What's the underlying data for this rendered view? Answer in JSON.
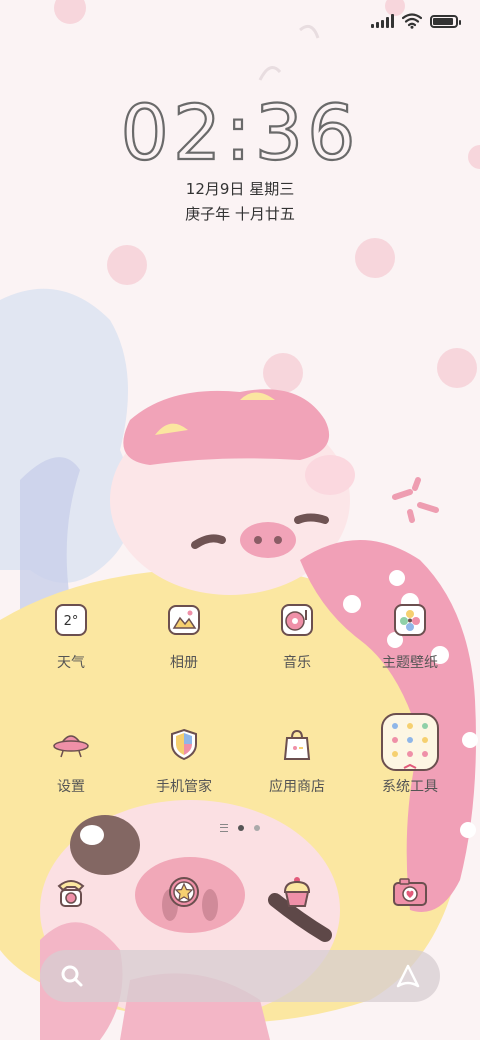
{
  "status_bar": {
    "battery_level": 0.9,
    "signal_bars": 5,
    "wifi": true
  },
  "clock": {
    "hours": "02",
    "separator": ":",
    "minutes": "36"
  },
  "date": {
    "solar": "12月9日 星期三",
    "lunar": "庚子年 十月廿五"
  },
  "apps": [
    {
      "label": "天气",
      "icon": "weather-icon",
      "temp_text": "2°"
    },
    {
      "label": "相册",
      "icon": "gallery-icon"
    },
    {
      "label": "音乐",
      "icon": "music-icon"
    },
    {
      "label": "主题壁纸",
      "icon": "theme-icon"
    },
    {
      "label": "设置",
      "icon": "settings-ufo-icon"
    },
    {
      "label": "手机管家",
      "icon": "security-shield-icon"
    },
    {
      "label": "应用商店",
      "icon": "app-store-bag-icon"
    },
    {
      "label": "系统工具",
      "icon": "tools-folder-icon"
    }
  ],
  "page_indicator": {
    "pages": 2,
    "current": 1
  },
  "dock": [
    {
      "icon": "phone-icon"
    },
    {
      "icon": "messages-star-icon"
    },
    {
      "icon": "browser-cupcake-icon"
    },
    {
      "icon": "camera-icon"
    }
  ],
  "search_bar": {
    "left_icon": "search-icon",
    "right_icon": "assistant-icon"
  },
  "colors": {
    "pink": "#f2a7bd",
    "yellow": "#fbe7a1",
    "bg": "#fbf3f4",
    "text": "#555555"
  }
}
